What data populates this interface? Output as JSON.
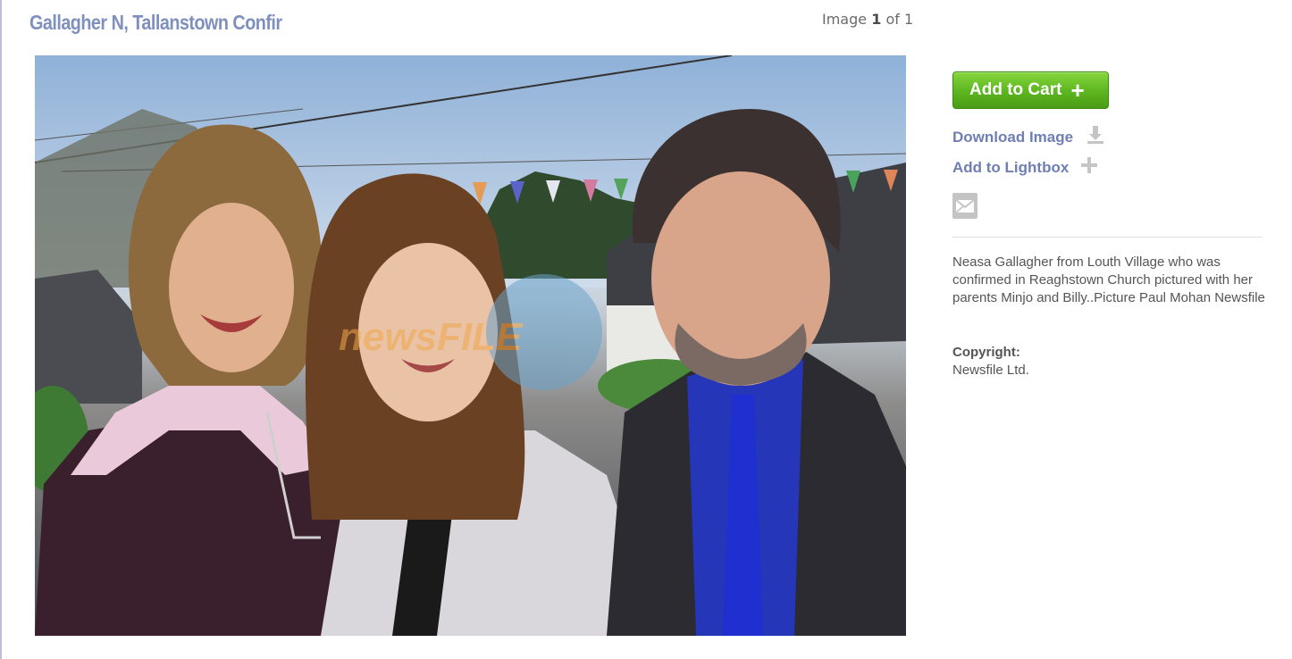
{
  "page": {
    "title": "Gallagher N, Tallanstown Confir",
    "counter": {
      "prefix": "Image",
      "current": "1",
      "of_label": "of",
      "total": "1"
    }
  },
  "photo": {
    "watermark_text": "newsFILE",
    "accent_color": "#7f8fbe"
  },
  "actions": {
    "add_to_cart_label": "Add to Cart",
    "add_to_cart_icon": "plus-icon",
    "download_label": "Download Image",
    "download_icon": "download-icon",
    "lightbox_label": "Add to Lightbox",
    "lightbox_icon": "plus-icon",
    "email_icon": "envelope-icon",
    "button_color": "#5fb822",
    "link_color": "#6f7fb4"
  },
  "details": {
    "caption": "Neasa Gallagher from Louth Village who was confirmed in Reaghstown Church pictured with her parents Minjo and Billy..Picture Paul Mohan Newsfile",
    "copyright_label": "Copyright:",
    "copyright_value": "Newsfile Ltd."
  }
}
